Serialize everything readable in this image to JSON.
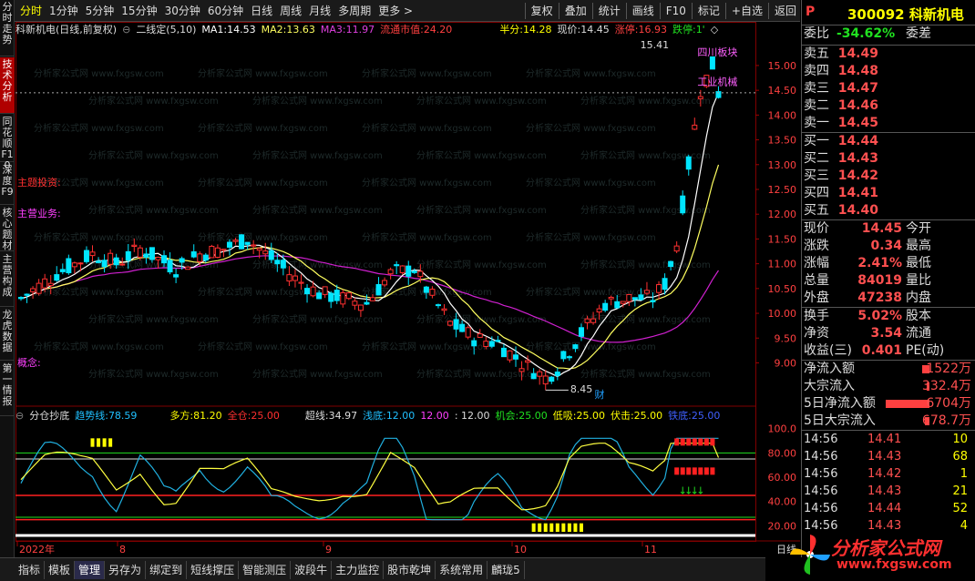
{
  "toolbar": {
    "left_items": [
      "分时",
      "1分钟",
      "5分钟",
      "15分钟",
      "30分钟",
      "60分钟",
      "日线",
      "周线",
      "月线",
      "多周期",
      "更多 >"
    ],
    "right_items": [
      "复权",
      "叠加",
      "统计",
      "画线",
      "F10",
      "标记",
      "+自选",
      "返回"
    ]
  },
  "left_tabs": [
    "分时走势",
    "技术分析",
    "同花顺F10",
    "深度F9",
    "核心题材",
    "主营构成",
    "龙虎数据",
    "第一情报"
  ],
  "chart": {
    "info": {
      "name": "科新机电(日线,前复权)",
      "indicator": "二线定(5,10)",
      "ma1_label": "MA1:",
      "ma1": "14.53",
      "ma2_label": "MA2:",
      "ma2": "13.63",
      "ma3_label": "MA3:",
      "ma3": "11.97",
      "float_label": "流通市值:",
      "float": "24.20",
      "half_label": "半分:",
      "half": "14.28",
      "price_label": "现价:",
      "price": "14.45",
      "limit_up_label": "涨停:",
      "limit_up": "16.93",
      "limit_down_label": "跌停:",
      "limit_down": "1'"
    },
    "annotations": {
      "topic": "主题投资:",
      "business": "主营业务:",
      "concept": "概念:",
      "high": "15.41",
      "low": "8.45",
      "tag_sichuan": "四川板块",
      "tag_industry": "工业机械",
      "tag_cai": "财"
    },
    "price_axis": [
      "15.00",
      "14.50",
      "14.00",
      "13.50",
      "13.00",
      "12.50",
      "12.00",
      "11.50",
      "11.00",
      "10.50",
      "10.00",
      "9.50",
      "9.00"
    ],
    "watermark": "分析家公式网 www.fxgsw.com"
  },
  "sub_indicator": {
    "name": "分仓抄底",
    "trend_label": "趋势线:",
    "trend": "78.59",
    "long_label": "多方:",
    "long": "81.20",
    "full_label": "全仓:",
    "full": "25.00",
    "line_label": "超线:",
    "line": "34.97",
    "shallow_label": "浅底:",
    "shallow": "12.00",
    "v1": "12.00",
    "v2": ": 12.00",
    "chance_label": "机会:",
    "chance": "25.00",
    "absorb_label": "低吸:",
    "absorb": "25.00",
    "strike_label": "伏击:",
    "strike": "25.00",
    "iron_label": "铁底:",
    "iron": "25.00",
    "axis": [
      "100.0",
      "80.00",
      "60.00",
      "40.00",
      "20.00"
    ]
  },
  "time_axis": [
    "2022年",
    "8",
    "9",
    "10",
    "11"
  ],
  "time_axis_right": "日线",
  "quote": {
    "p": "P",
    "code_name": "300092 科新机电",
    "weibi_label": "委比",
    "weibi": "-34.62%",
    "weicha_label": "委差",
    "sells": [
      {
        "label": "卖五",
        "price": "14.49"
      },
      {
        "label": "卖四",
        "price": "14.48"
      },
      {
        "label": "卖三",
        "price": "14.47"
      },
      {
        "label": "卖二",
        "price": "14.46"
      },
      {
        "label": "卖一",
        "price": "14.45"
      }
    ],
    "buys": [
      {
        "label": "买一",
        "price": "14.44"
      },
      {
        "label": "买二",
        "price": "14.43"
      },
      {
        "label": "买三",
        "price": "14.42"
      },
      {
        "label": "买四",
        "price": "14.41"
      },
      {
        "label": "买五",
        "price": "14.40"
      }
    ],
    "stats": [
      {
        "label": "现价",
        "value": "14.45",
        "label2": "今开"
      },
      {
        "label": "涨跌",
        "value": "0.34",
        "label2": "最高"
      },
      {
        "label": "涨幅",
        "value": "2.41%",
        "label2": "最低"
      },
      {
        "label": "总量",
        "value": "84019",
        "label2": "量比"
      },
      {
        "label": "外盘",
        "value": "47238",
        "label2": "内盘"
      }
    ],
    "stats2": [
      {
        "label": "换手",
        "value": "5.02%",
        "label2": "股本"
      },
      {
        "label": "净资",
        "value": "3.54",
        "label2": "流通"
      },
      {
        "label": "收益(三)",
        "value": "0.401",
        "label2": "PE(动)"
      }
    ],
    "flows": [
      {
        "label": "净流入额",
        "value": "1522万",
        "bar": 0.05
      },
      {
        "label": "大宗流入",
        "value": "332.4万",
        "bar": 0.02
      },
      {
        "label": "5日净流入额",
        "value": "6704万",
        "bar": 0.3
      },
      {
        "label": "5日大宗流入",
        "value": "678.7万",
        "bar": 0.03
      }
    ],
    "ticks": [
      {
        "time": "14:56",
        "price": "14.41",
        "vol": "10"
      },
      {
        "time": "14:56",
        "price": "14.43",
        "vol": "68"
      },
      {
        "time": "14:56",
        "price": "14.42",
        "vol": "1"
      },
      {
        "time": "14:56",
        "price": "14.43",
        "vol": "21"
      },
      {
        "time": "14:56",
        "price": "14.44",
        "vol": "52"
      },
      {
        "time": "14:56",
        "price": "14.43",
        "vol": "4"
      }
    ]
  },
  "bottom_tabs": [
    "指标",
    "模板",
    "管理",
    "另存为",
    "绑定到",
    "短线撑压",
    "智能测压",
    "波段牛",
    "主力监控",
    "股市乾坤",
    "系统常用",
    "麟珑5"
  ],
  "logo": {
    "text": "分析家公式网",
    "url": "www.fxgsw.com"
  },
  "colors": {
    "up": "#ff3030",
    "down": "#00e5ff",
    "ma1": "#ffffff",
    "ma2": "#ffff60",
    "ma3": "#d020d0",
    "accent": "#ffff00"
  }
}
